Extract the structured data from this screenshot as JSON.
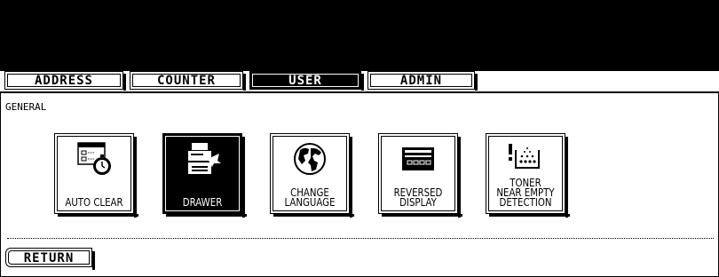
{
  "tabs": [
    {
      "label": "ADDRESS",
      "active": false
    },
    {
      "label": "COUNTER",
      "active": false
    },
    {
      "label": "USER",
      "active": true
    },
    {
      "label": "ADMIN",
      "active": false
    }
  ],
  "section_title": "GENERAL",
  "function_buttons": [
    {
      "label": "AUTO CLEAR",
      "icon": "timer-icon",
      "selected": false
    },
    {
      "label": "DRAWER",
      "icon": "drawer-icon",
      "selected": true
    },
    {
      "label": "CHANGE\nLANGUAGE",
      "icon": "globe-icon",
      "selected": false
    },
    {
      "label": "REVERSED\nDISPLAY",
      "icon": "reversed-display-icon",
      "selected": false
    },
    {
      "label": "TONER\nNEAR EMPTY\nDETECTION",
      "icon": "toner-icon",
      "selected": false
    }
  ],
  "return_button": {
    "label": "RETURN"
  },
  "colors": {
    "background": "#ffffff",
    "foreground": "#000000"
  }
}
